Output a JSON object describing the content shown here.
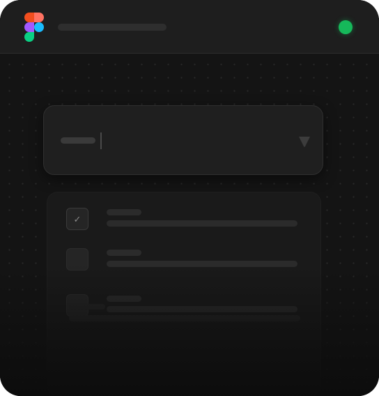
{
  "app": {
    "logo_icon": "figma-logo-icon",
    "status_color": "#16b85a"
  },
  "select": {
    "arrow_icon": "triangle-down-icon"
  },
  "list": {
    "items": [
      {
        "checked": true
      },
      {
        "checked": false
      },
      {
        "checked": false
      }
    ]
  }
}
